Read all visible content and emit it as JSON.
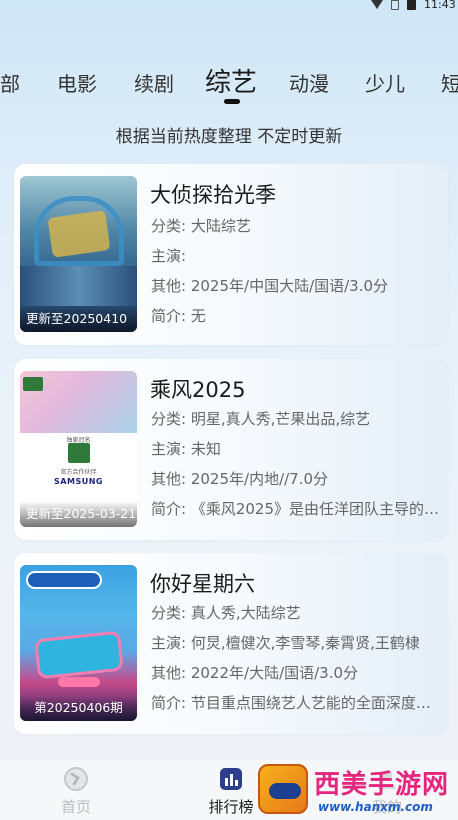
{
  "status_bar": {
    "time": "11:43"
  },
  "tabs": [
    {
      "label": "部",
      "active": false
    },
    {
      "label": "电影",
      "active": false
    },
    {
      "label": "续剧",
      "active": false
    },
    {
      "label": "综艺",
      "active": true
    },
    {
      "label": "动漫",
      "active": false
    },
    {
      "label": "少儿",
      "active": false
    },
    {
      "label": "短",
      "active": false
    }
  ],
  "subtitle": "根据当前热度整理 不定时更新",
  "labels": {
    "category": "分类:",
    "cast": "主演:",
    "other": "其他:",
    "intro": "简介:"
  },
  "shows": [
    {
      "title": "大侦探拾光季",
      "category": "大陆综艺",
      "cast": "",
      "other": "2025年/中国大陆/国语/3.0分",
      "intro": "无",
      "update": "更新至20250410"
    },
    {
      "title": "乘风2025",
      "category": "明星,真人秀,芒果出品,综艺",
      "cast": "未知",
      "other": "2025年/内地//7.0分",
      "intro": "《乘风2025》是由任洋团队主导的…",
      "update": "更新至2025-03-21",
      "poster_text": {
        "presenter": "独家冠名",
        "brand_line": "官方合作伙伴",
        "samsung": "SAMSUNG"
      }
    },
    {
      "title": "你好星期六",
      "category": "真人秀,大陆综艺",
      "cast": "何炅,檀健次,李雪琴,秦霄贤,王鹤棣",
      "other": "2022年/大陆/国语/3.0分",
      "intro": "节目重点围绕艺人艺能的全面深度挖掘",
      "update": "第20250406期"
    }
  ],
  "bottom_nav": [
    {
      "label": "首页",
      "active": false
    },
    {
      "label": "排行榜",
      "active": true
    },
    {
      "label": "我的",
      "active": false
    }
  ],
  "watermark": {
    "title": "西美手游网",
    "url": "www.hanxm.com"
  },
  "colors": {
    "accent": "#1a1a1a",
    "inactive_nav": "#b9bcc0",
    "watermark_title": "#e5267e",
    "watermark_url": "#1d5fc4"
  }
}
